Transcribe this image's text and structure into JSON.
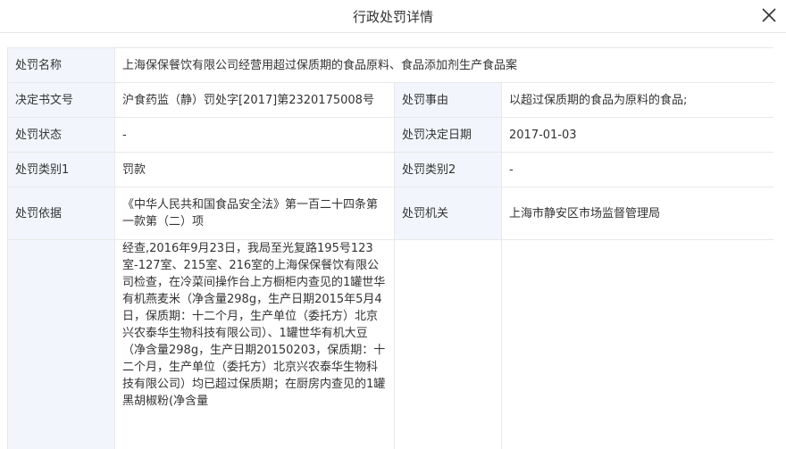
{
  "dialog": {
    "title": "行政处罚详情",
    "close_icon": "close-icon"
  },
  "fields": {
    "name_label": "处罚名称",
    "name_value": "上海保保餐饮有限公司经营用超过保质期的食品原料、食品添加剂生产食品案",
    "doc_no_label": "决定书文号",
    "doc_no_value": "沪食药监（静）罚处字[2017]第2320175008号",
    "matter_label": "处罚事由",
    "matter_value": "以超过保质期的食品为原料的食品;",
    "status_label": "处罚状态",
    "status_value": "-",
    "date_label": "处罚决定日期",
    "date_value": "2017-01-03",
    "type1_label": "处罚类别1",
    "type1_value": "罚款",
    "type2_label": "处罚类别2",
    "type2_value": "-",
    "basis_label": "处罚依据",
    "basis_value": "《中华人民共和国食品安全法》第一百二十四条第一款第（二）项",
    "authority_label": "处罚机关",
    "authority_value": "上海市静安区市场监督管理局",
    "detail_value": "经查,2016年9月23日，我局至光复路195号123室-127室、215室、216室的上海保保餐饮有限公司检查，在冷菜间操作台上方橱柜内查见的1罐世华有机燕麦米（净含量298g，生产日期2015年5月4日，保质期：十二个月，生产单位（委托方）北京兴农泰华生物科技有限公司）、1罐世华有机大豆（净含量298g，生产日期20150203，保质期：十二个月，生产单位（委托方）北京兴农泰华生物科技有限公司）均已超过保质期；在厨房内查见的1罐黑胡椒粉(净含量"
  }
}
